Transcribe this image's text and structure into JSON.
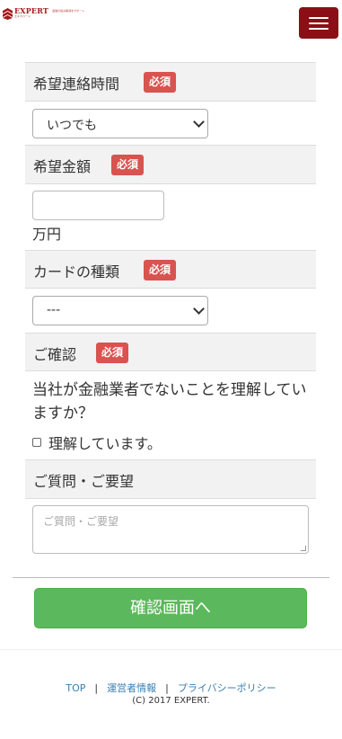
{
  "header": {
    "logo_name": "EXPERT",
    "logo_sub": "エキスパート",
    "logo_desc": "金融の悩み解消をサポート",
    "menu_icon": "hamburger-icon"
  },
  "colors": {
    "brand": "#8b0f16",
    "required_badge": "#d9534f",
    "submit": "#5cb85c",
    "link": "#3a7fb0",
    "row_header": "#f2f2f2"
  },
  "form": {
    "contact_time": {
      "label": "希望連絡時間",
      "required": "必須",
      "selected": "いつでも"
    },
    "amount": {
      "label": "希望金額",
      "required": "必須",
      "value": "",
      "unit": "万円"
    },
    "card_type": {
      "label": "カードの種類",
      "required": "必須",
      "selected": "---"
    },
    "confirm": {
      "label": "ご確認",
      "required": "必須",
      "question": "当社が金融業者でないことを理解していますか？",
      "checkbox_label": "理解しています。",
      "checked": false
    },
    "inquiry": {
      "label": "ご質問・ご要望",
      "placeholder": "ご質問・ご要望"
    },
    "submit_label": "確認画面へ"
  },
  "footer": {
    "links": [
      "TOP",
      "運営者情報",
      "プライバシーポリシー"
    ],
    "separator": "|",
    "copyright": "(C) 2017 EXPERT."
  }
}
